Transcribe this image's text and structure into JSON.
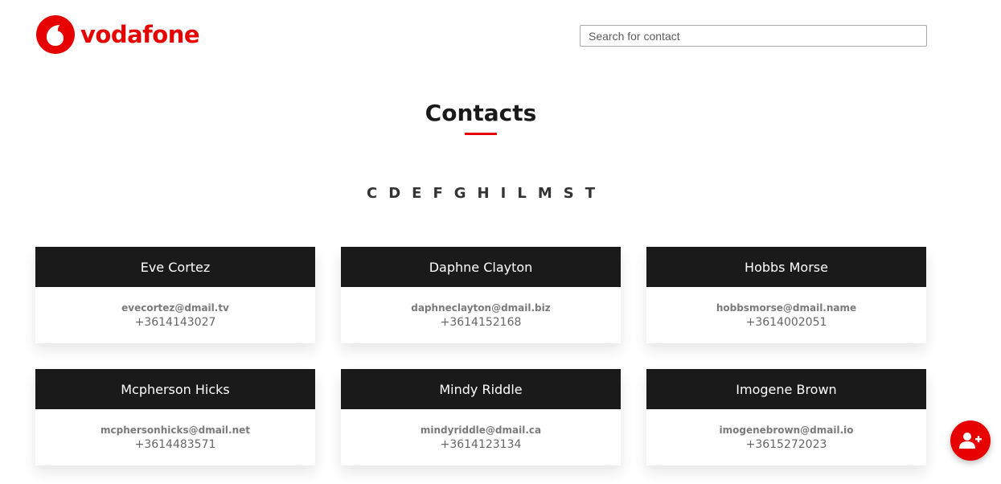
{
  "brand": {
    "name": "vodafone",
    "color": "#e60000",
    "logo_icon": "vodafone-speechmark-icon"
  },
  "search": {
    "placeholder": "Search for contact",
    "value": ""
  },
  "page": {
    "title": "Contacts"
  },
  "alphabet": [
    "C",
    "D",
    "E",
    "F",
    "G",
    "H",
    "I",
    "L",
    "M",
    "S",
    "T"
  ],
  "contacts": [
    {
      "name": "Eve Cortez",
      "email": "evecortez@dmail.tv",
      "phone": "+3614143027"
    },
    {
      "name": "Daphne Clayton",
      "email": "daphneclayton@dmail.biz",
      "phone": "+3614152168"
    },
    {
      "name": "Hobbs Morse",
      "email": "hobbsmorse@dmail.name",
      "phone": "+3614002051"
    },
    {
      "name": "Mcpherson Hicks",
      "email": "mcphersonhicks@dmail.net",
      "phone": "+3614483571"
    },
    {
      "name": "Mindy Riddle",
      "email": "mindyriddle@dmail.ca",
      "phone": "+3614123134"
    },
    {
      "name": "Imogene Brown",
      "email": "imogenebrown@dmail.io",
      "phone": "+3615272023"
    }
  ],
  "fab": {
    "icon": "add-user-icon"
  }
}
